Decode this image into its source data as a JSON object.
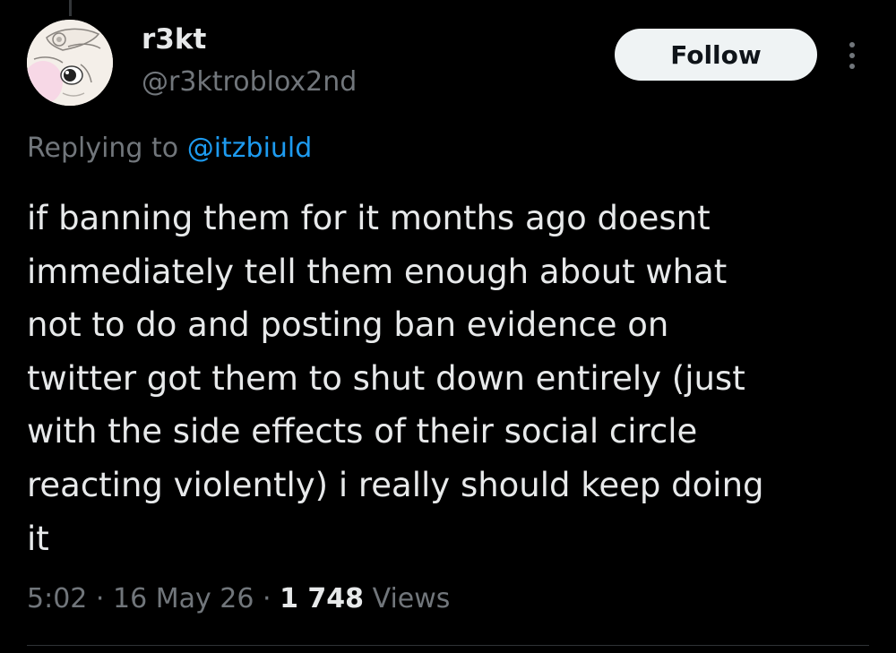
{
  "author": {
    "display_name": "r3kt",
    "handle": "@r3ktroblox2nd"
  },
  "follow_button": {
    "label": "Follow"
  },
  "reply_context": {
    "prefix": "Replying to",
    "mention": "@itzbiuld"
  },
  "tweet": {
    "lines": [
      "if banning them for it months ago doesnt",
      "immediately tell them enough about what",
      "not to do and posting ban evidence on",
      "twitter got them to shut down entirely (just",
      "with the side effects of their social circle",
      "reacting violently) i really should keep doing",
      "it"
    ]
  },
  "meta": {
    "time": "5:02",
    "separator": "·",
    "date": "16 May 26",
    "views_count": "1 748",
    "views_label": "Views"
  },
  "icons": {
    "more": "more-vertical-icon"
  },
  "colors": {
    "background": "#000000",
    "primary_text": "#e7e9ea",
    "secondary_text": "#71767b",
    "link": "#1d9bf0",
    "follow_button_bg": "#eff3f4"
  }
}
